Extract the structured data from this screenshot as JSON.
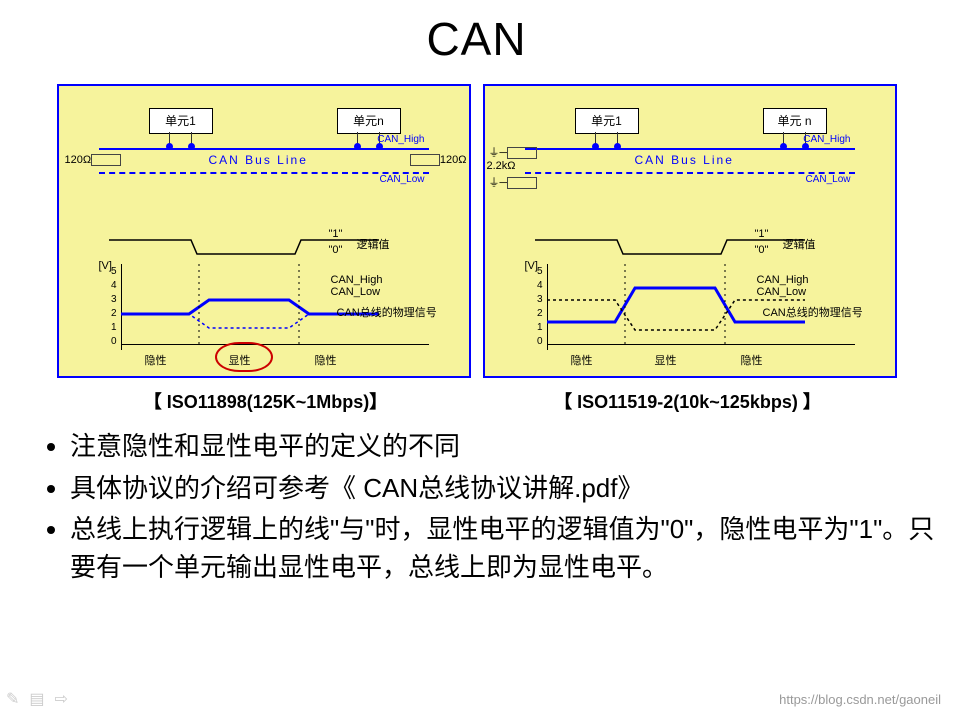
{
  "title": "CAN",
  "panel": {
    "unit1": "单元1",
    "unitN_left": "单元n",
    "unitN_right": "单元 n",
    "canHigh": "CAN_High",
    "canLow": "CAN_Low",
    "busLine": "CAN Bus Line",
    "leftTerm": "120Ω",
    "rightTermLeft": "120Ω",
    "rightTermRight": "2.2kΩ",
    "logicLabel": "逻辑值",
    "logicHi": "\"1\"",
    "logicLo": "\"0\"",
    "phyLabel": "CAN总线的物理信号",
    "chHigh": "CAN_High",
    "chLow": "CAN_Low",
    "vUnit": "[V]",
    "yticks": [
      "0",
      "1",
      "2",
      "3",
      "4",
      "5"
    ],
    "xlabels": [
      "隐性",
      "显性",
      "隐性"
    ]
  },
  "captions": {
    "left": "【 ISO11898(125K~1Mbps)】",
    "right": "【 ISO11519-2(10k~125kbps) 】"
  },
  "bullets": [
    "注意隐性和显性电平的定义的不同",
    "具体协议的介绍可参考《 CAN总线协议讲解.pdf》",
    "总线上执行逻辑上的线\"与\"时，显性电平的逻辑值为\"0\"，隐性电平为\"1\"。只要有一个单元输出显性电平，总线上即为显性电平。"
  ],
  "watermark": "https://blog.csdn.net/gaoneil",
  "chart_data": [
    {
      "type": "line",
      "title": "ISO11898 CAN物理层电平",
      "xlabel": "",
      "ylabel": "[V]",
      "ylim": [
        0,
        5
      ],
      "series": [
        {
          "name": "CAN_High",
          "x": [
            0,
            1,
            2,
            3,
            4
          ],
          "y": [
            2.5,
            2.5,
            3.5,
            3.5,
            2.5
          ]
        },
        {
          "name": "CAN_Low",
          "x": [
            0,
            1,
            2,
            3,
            4
          ],
          "y": [
            2.5,
            2.5,
            1.5,
            1.5,
            2.5
          ]
        },
        {
          "name": "逻辑值",
          "x": [
            0,
            1,
            2,
            3,
            4
          ],
          "y": [
            1,
            1,
            0,
            0,
            1
          ]
        }
      ],
      "x_segments": [
        "隐性",
        "显性",
        "隐性"
      ]
    },
    {
      "type": "line",
      "title": "ISO11519-2 CAN物理层电平",
      "xlabel": "",
      "ylabel": "[V]",
      "ylim": [
        0,
        5
      ],
      "series": [
        {
          "name": "CAN_High",
          "x": [
            0,
            1,
            2,
            3,
            4
          ],
          "y": [
            1.75,
            1.75,
            4.0,
            4.0,
            1.75
          ]
        },
        {
          "name": "CAN_Low",
          "x": [
            0,
            1,
            2,
            3,
            4
          ],
          "y": [
            3.25,
            3.25,
            1.0,
            1.0,
            3.25
          ]
        },
        {
          "name": "逻辑值",
          "x": [
            0,
            1,
            2,
            3,
            4
          ],
          "y": [
            1,
            1,
            0,
            0,
            1
          ]
        }
      ],
      "x_segments": [
        "隐性",
        "显性",
        "隐性"
      ]
    }
  ]
}
